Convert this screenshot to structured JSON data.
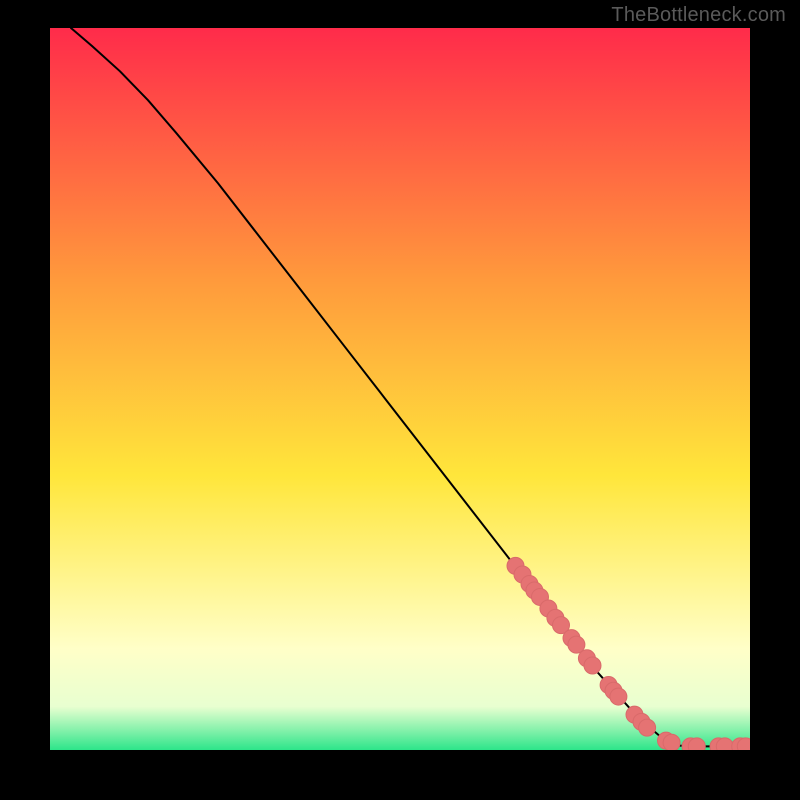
{
  "watermark": "TheBottleneck.com",
  "colors": {
    "gradient_top": "#ff2b4a",
    "gradient_mid_orange": "#ff9a3c",
    "gradient_yellow": "#ffe63b",
    "gradient_pale": "#ffffc8",
    "gradient_green": "#2de58a",
    "curve": "#000000",
    "marker_fill": "#e57373",
    "marker_stroke": "#d96a6a"
  },
  "chart_data": {
    "type": "line",
    "title": "",
    "xlabel": "",
    "ylabel": "",
    "xlim": [
      0,
      100
    ],
    "ylim": [
      0,
      100
    ],
    "grid": false,
    "legend": false,
    "series": [
      {
        "name": "curve",
        "x": [
          3,
          6,
          10,
          14,
          18,
          24,
          30,
          36,
          42,
          48,
          54,
          60,
          66,
          72,
          78,
          84,
          88,
          90,
          91.5,
          93,
          95,
          97,
          99,
          100
        ],
        "y": [
          100,
          97.5,
          94,
          90,
          85.5,
          78.5,
          71,
          63.5,
          56,
          48.5,
          41,
          33.5,
          26,
          18.5,
          11,
          4.5,
          1.2,
          0.6,
          0.5,
          0.5,
          0.5,
          0.5,
          0.5,
          0.5
        ]
      }
    ],
    "markers": [
      {
        "x": 66.5,
        "y": 25.5
      },
      {
        "x": 67.5,
        "y": 24.3
      },
      {
        "x": 68.5,
        "y": 23.0
      },
      {
        "x": 69.2,
        "y": 22.1
      },
      {
        "x": 70.0,
        "y": 21.2
      },
      {
        "x": 71.2,
        "y": 19.6
      },
      {
        "x": 72.2,
        "y": 18.3
      },
      {
        "x": 73.0,
        "y": 17.3
      },
      {
        "x": 74.5,
        "y": 15.5
      },
      {
        "x": 75.2,
        "y": 14.6
      },
      {
        "x": 76.7,
        "y": 12.7
      },
      {
        "x": 77.5,
        "y": 11.7
      },
      {
        "x": 79.8,
        "y": 9.0
      },
      {
        "x": 80.5,
        "y": 8.2
      },
      {
        "x": 81.2,
        "y": 7.4
      },
      {
        "x": 83.5,
        "y": 4.9
      },
      {
        "x": 84.5,
        "y": 3.9
      },
      {
        "x": 85.3,
        "y": 3.1
      },
      {
        "x": 88.0,
        "y": 1.3
      },
      {
        "x": 88.8,
        "y": 1.0
      },
      {
        "x": 91.5,
        "y": 0.5
      },
      {
        "x": 92.4,
        "y": 0.5
      },
      {
        "x": 95.5,
        "y": 0.5
      },
      {
        "x": 96.4,
        "y": 0.5
      },
      {
        "x": 98.6,
        "y": 0.5
      },
      {
        "x": 99.4,
        "y": 0.5
      }
    ]
  }
}
